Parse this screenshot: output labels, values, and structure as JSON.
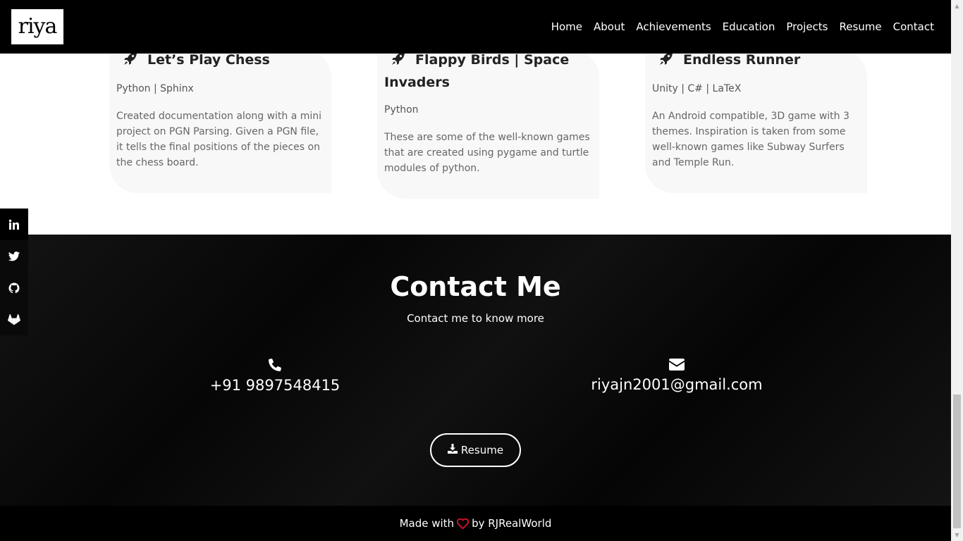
{
  "brand": {
    "logo_text": "riya"
  },
  "nav": {
    "items": [
      {
        "label": "Home"
      },
      {
        "label": "About"
      },
      {
        "label": "Achievements"
      },
      {
        "label": "Education"
      },
      {
        "label": "Projects"
      },
      {
        "label": "Resume"
      },
      {
        "label": "Contact"
      }
    ]
  },
  "projects": [
    {
      "title": "Let’s Play Chess",
      "tech": "Python | Sphinx",
      "desc": "Created documentation along with a mini project on PGN Parsing. Given a PGN file, it tells the final positions of the pieces on the chess board.",
      "icon": "rocket-icon"
    },
    {
      "title": "Flappy Birds | Space Invaders",
      "tech": "Python",
      "desc": "These are some of the well-known games that are created using pygame and turtle modules of python.",
      "icon": "rocket-icon"
    },
    {
      "title": "Endless Runner",
      "tech": "Unity | C# | LaTeX",
      "desc": "An Android compatible, 3D game with 3 themes. Inspiration is taken from some well-known games like Subway Surfers and Temple Run.",
      "icon": "rocket-icon"
    }
  ],
  "social": [
    "linkedin-icon",
    "twitter-icon",
    "github-icon",
    "gitlab-icon"
  ],
  "contact": {
    "heading": "Contact Me",
    "subheading": "Contact me to know more",
    "phone": "+91 9897548415",
    "email": "riyajn2001@gmail.com",
    "resume_label": "Resume"
  },
  "footer": {
    "made_with": "Made with",
    "by": "by RJRealWorld"
  },
  "colors": {
    "heart": "#e0112b",
    "navbar": "#000000",
    "card_bg": "#f8f8f8"
  }
}
